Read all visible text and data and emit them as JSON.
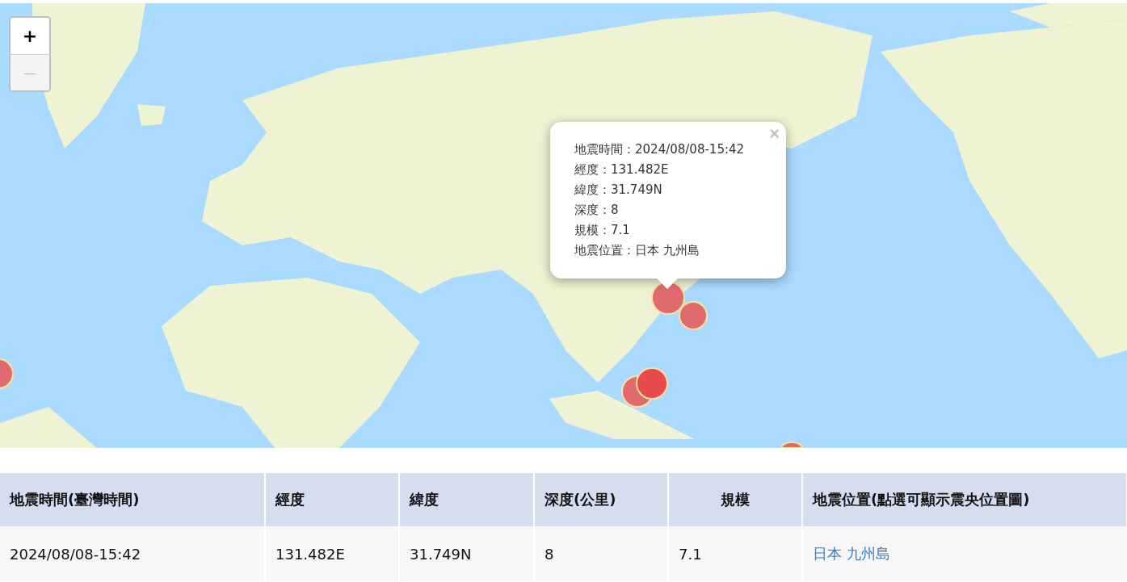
{
  "map": {
    "zoom_controls": [
      {
        "label": "+",
        "disabled": false
      },
      {
        "label": "—",
        "disabled": true
      }
    ],
    "popup": {
      "close": "×",
      "lines": [
        "地震時間：2024/08/08-15:42",
        "經度：131.482E",
        "緯度：31.749N",
        "深度：8",
        "規模：7.1",
        "地震位置：日本 九州島"
      ]
    }
  },
  "table": {
    "columns": [
      {
        "label": "地震時間(臺灣時間)"
      },
      {
        "label": "經度"
      },
      {
        "label": "緯度"
      },
      {
        "label": "深度(公里)"
      },
      {
        "label": "規模"
      },
      {
        "label": "地震位置(點選可顯示震央位置圖)"
      }
    ],
    "rows": [
      {
        "cells": [
          {
            "kind": "text",
            "text": "2024/08/08-15:42"
          },
          {
            "kind": "text",
            "text": "131.482E"
          },
          {
            "kind": "text",
            "text": "31.749N"
          },
          {
            "kind": "text",
            "text": "8"
          },
          {
            "kind": "text",
            "text": "7.1"
          },
          {
            "kind": "link",
            "text": "日本 九州島"
          }
        ]
      }
    ]
  }
}
